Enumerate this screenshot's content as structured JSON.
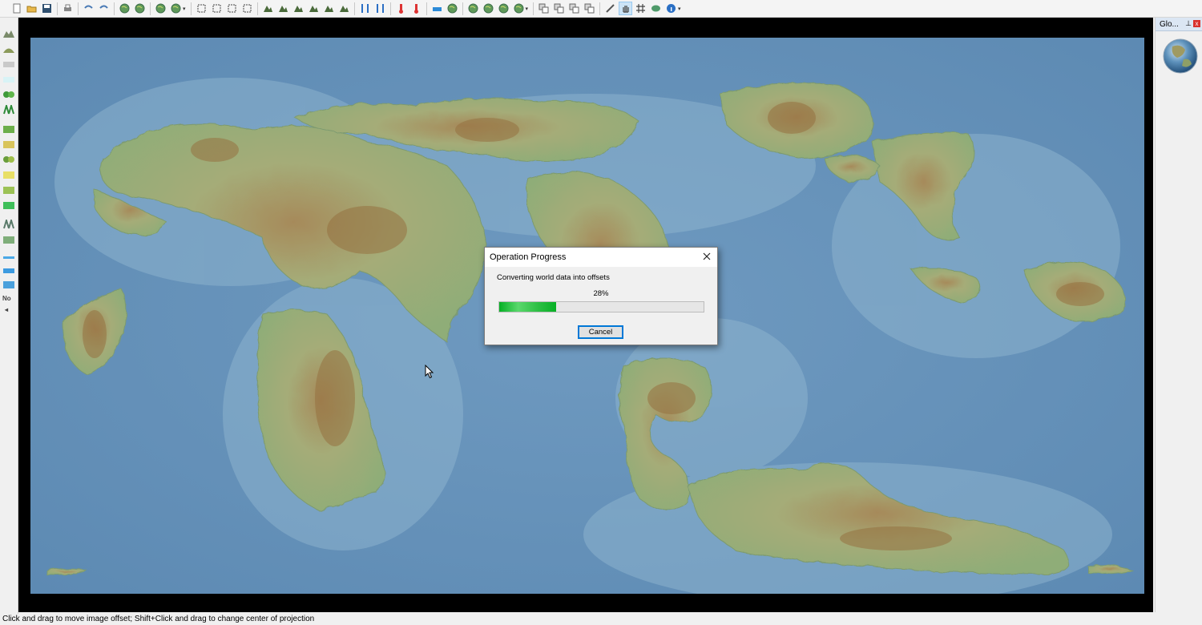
{
  "toolbar": {
    "groups": [
      [
        "new-file-icon",
        "open-folder-icon",
        "save-icon"
      ],
      [
        "print-icon"
      ],
      [
        "undo-icon",
        "redo-icon"
      ],
      [
        "globe-generate-icon",
        "globe-filter-icon"
      ],
      [
        "rotate-globe-icon",
        "globe-menu-icon"
      ],
      [
        "rect-select-icon",
        "ellipse-select-icon",
        "lasso-select-icon",
        "poly-select-icon"
      ],
      [
        "raise-land-icon",
        "lower-land-icon",
        "landmass-icon",
        "mountain-icon",
        "peak-icon",
        "flatten-icon"
      ],
      [
        "erode-icon",
        "smooth-icon"
      ],
      [
        "temp-up-icon",
        "temp-down-icon"
      ],
      [
        "water-level-icon",
        "ocean-icon"
      ],
      [
        "climate-icon",
        "globe-view-icon",
        "world-icon",
        "globe-options-icon"
      ],
      [
        "copy-icon",
        "paste-icon",
        "stamp-icon",
        "clone-icon"
      ],
      [
        "ruler-icon",
        "hand-pan-icon",
        "grid-icon",
        "layers-icon",
        "info-icon"
      ]
    ],
    "active": "hand-pan-icon"
  },
  "palette": {
    "no_label": "No",
    "arrow": "◂"
  },
  "globe_panel": {
    "title": "Glo...",
    "pin": "⊥",
    "close": "x"
  },
  "dialog": {
    "title": "Operation Progress",
    "message": "Converting world data into offsets",
    "progress": 0.28,
    "progress_text": "28%",
    "cancel_label": "Cancel",
    "accent": "#06b025"
  },
  "statusbar": {
    "text": "Click and drag to move image offset; Shift+Click and drag to change center of projection"
  }
}
